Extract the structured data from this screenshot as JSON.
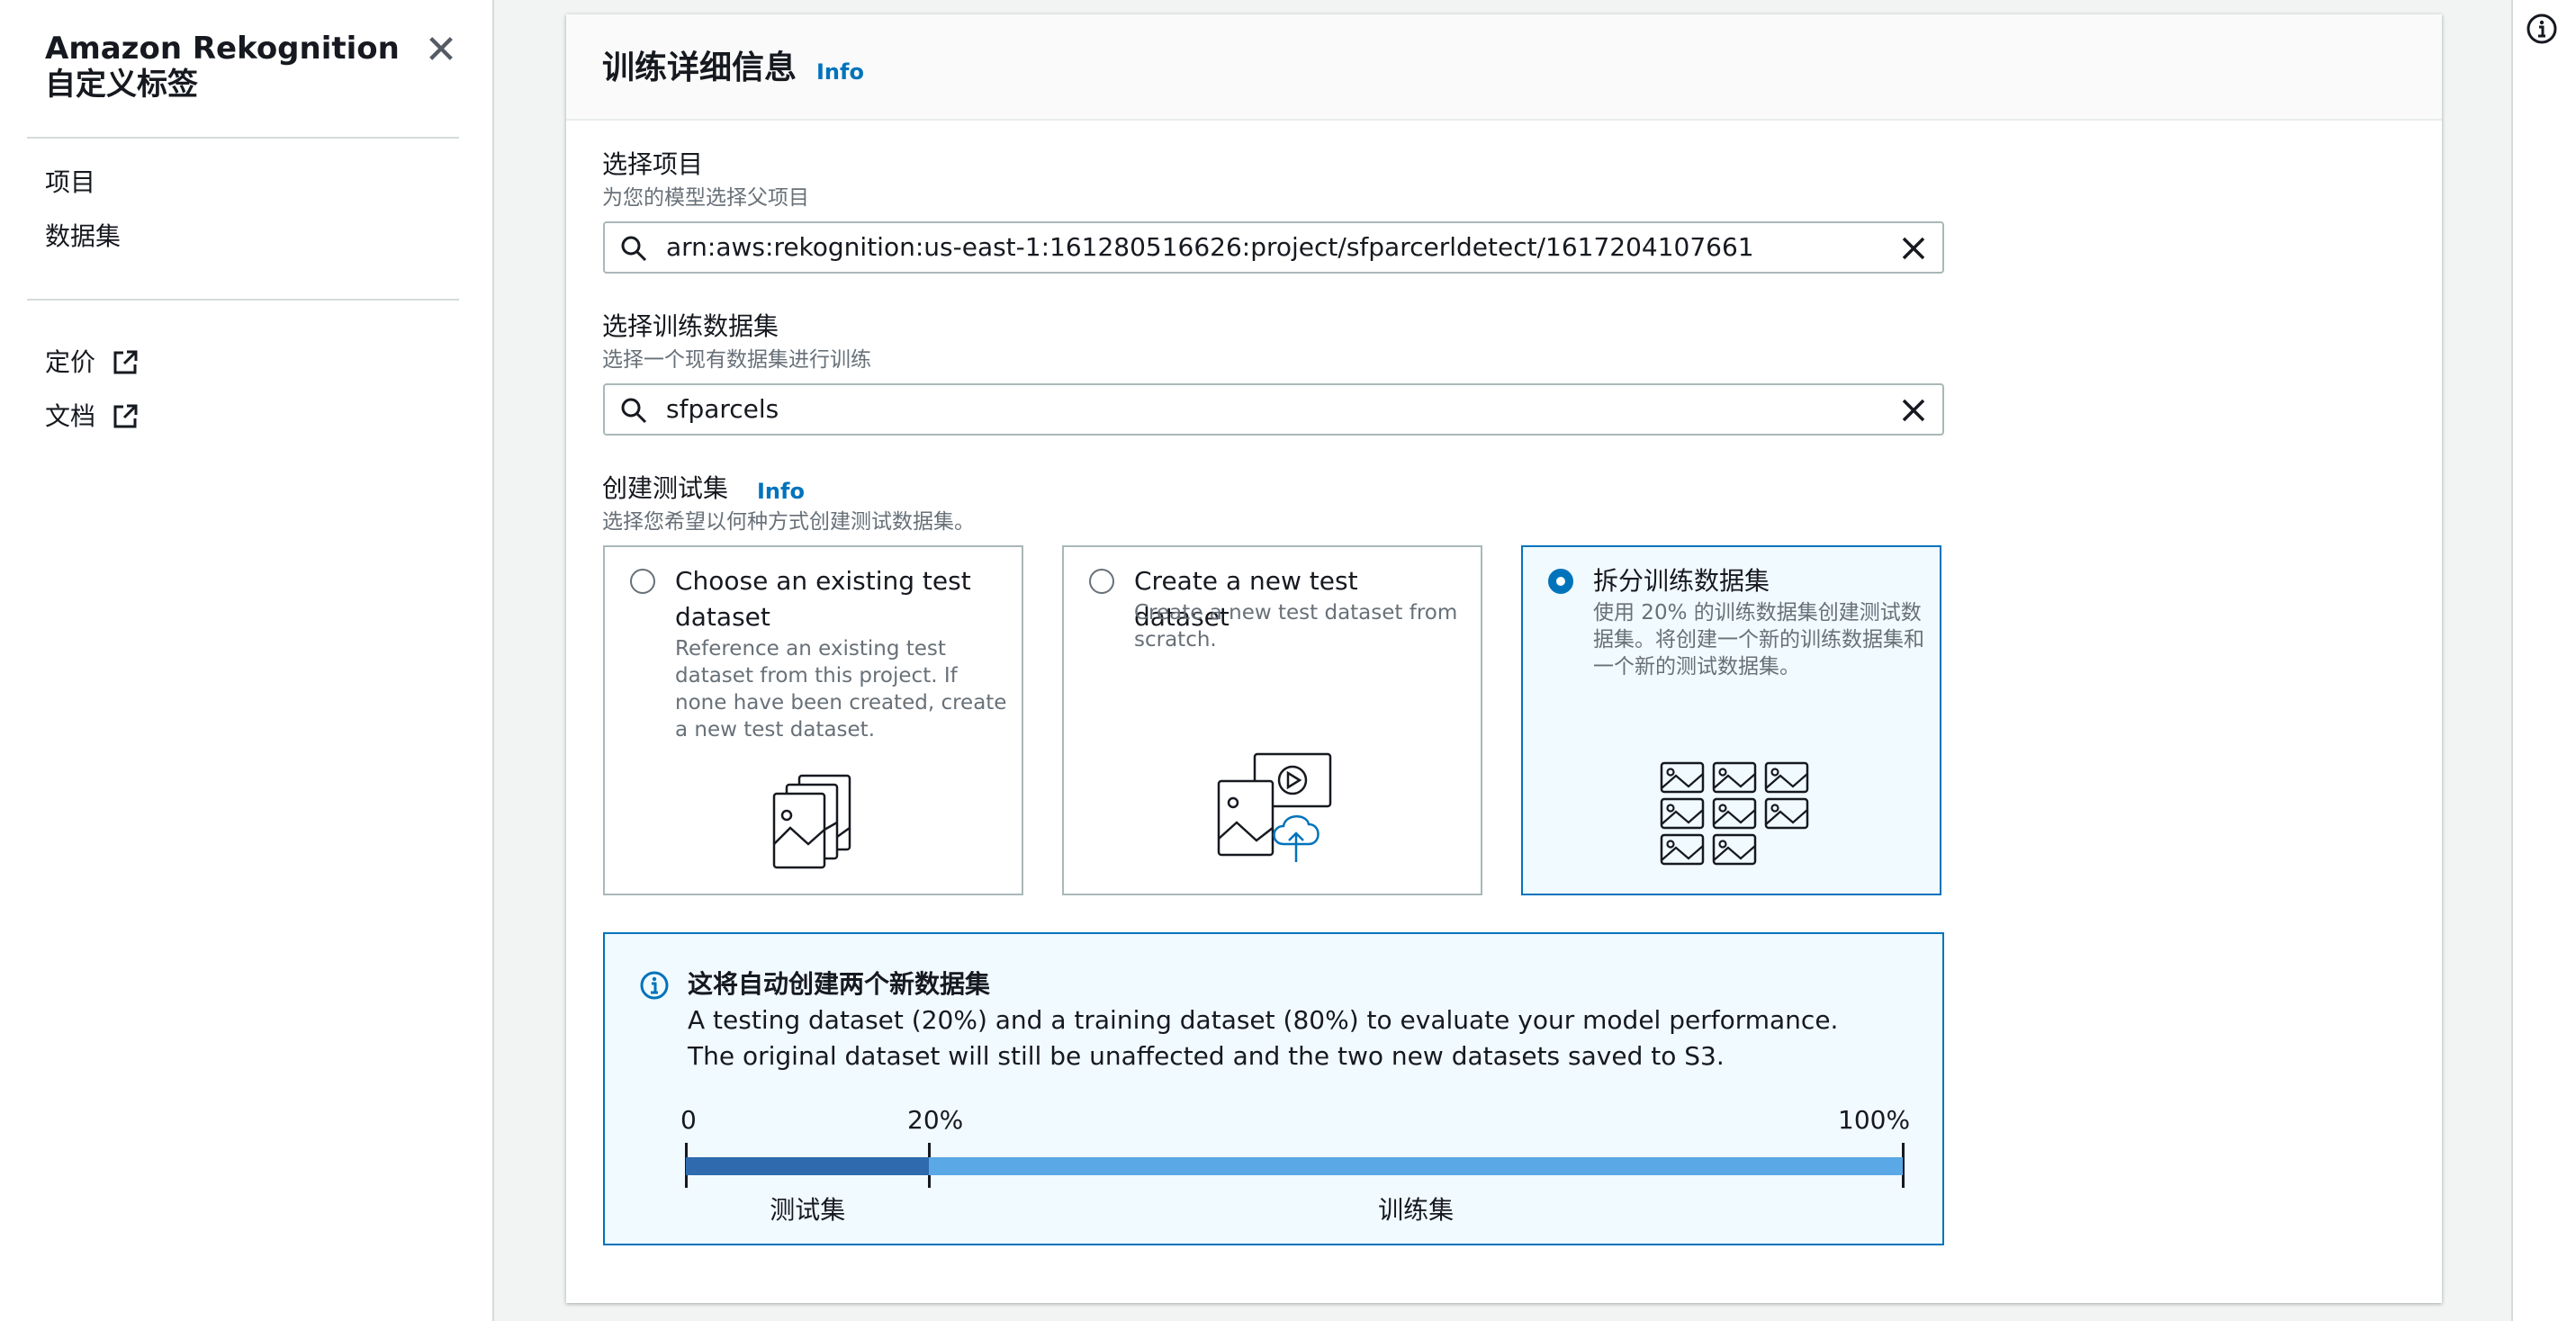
{
  "sidebar": {
    "title": "Amazon Rekognition\n自定义标签",
    "close_icon": "close-icon",
    "items": [
      {
        "label": "项目"
      },
      {
        "label": "数据集"
      }
    ],
    "external_links": [
      {
        "label": "定价",
        "icon": "external-link-icon"
      },
      {
        "label": "文档",
        "icon": "external-link-icon"
      }
    ]
  },
  "help_rail": {
    "icon": "info-icon"
  },
  "panel": {
    "title": "训练详细信息",
    "info_link": "Info"
  },
  "project_field": {
    "label": "选择项目",
    "description": "为您的模型选择父项目",
    "value": "arn:aws:rekognition:us-east-1:161280516626:project/sfparcerldetect/1617204107661"
  },
  "dataset_field": {
    "label": "选择训练数据集",
    "description": "选择一个现有数据集进行训练",
    "value": "sfparcels"
  },
  "test_set": {
    "label": "创建测试集",
    "info_link": "Info",
    "description": "选择您希望以何种方式创建测试数据集。",
    "options": [
      {
        "title": "Choose an existing test dataset",
        "description": "Reference an existing test dataset from this project. If none have been created, create a new test dataset.",
        "selected": false
      },
      {
        "title": "Create a new test dataset",
        "description": "Create a new test dataset from scratch.",
        "selected": false
      },
      {
        "title": "拆分训练数据集",
        "description": "使用 20% 的训练数据集创建测试数据集。将创建一个新的训练数据集和一个新的测试数据集。",
        "selected": true
      }
    ]
  },
  "alert": {
    "title": "这将自动创建两个新数据集",
    "line1": "A testing dataset (20%) and a training dataset (80%) to evaluate your model performance.",
    "line2": "The original dataset will still be unaffected and the two new datasets saved to S3.",
    "split": {
      "start_label": "0",
      "split_label": "20%",
      "end_label": "100%",
      "test_fraction": 0.2,
      "test_label": "测试集",
      "train_label": "训练集",
      "test_color": "#2e6aad",
      "train_color": "#5aa8e6"
    }
  }
}
